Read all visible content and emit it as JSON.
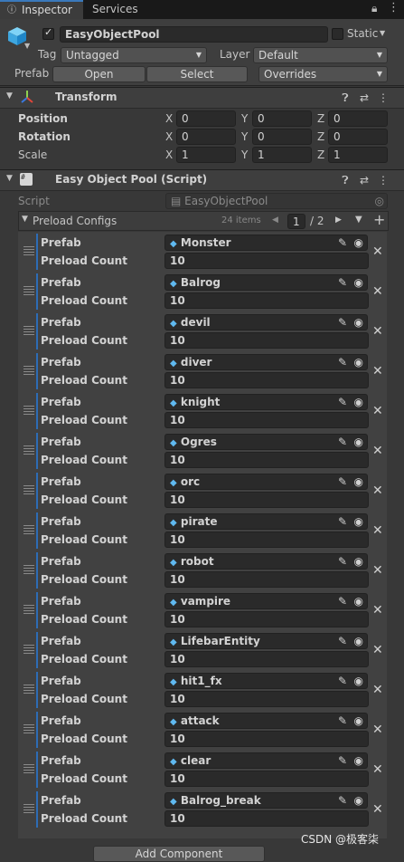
{
  "tabs": [
    {
      "label": "Inspector"
    },
    {
      "label": "Services"
    }
  ],
  "header": {
    "object_name": "EasyObjectPool",
    "static_label": "Static",
    "tag_label": "Tag",
    "tag_value": "Untagged",
    "layer_label": "Layer",
    "layer_value": "Default",
    "prefab_label": "Prefab",
    "open_label": "Open",
    "select_label": "Select",
    "overrides_label": "Overrides"
  },
  "transform": {
    "title": "Transform",
    "rows": [
      {
        "label": "Position",
        "x": "0",
        "y": "0",
        "z": "0"
      },
      {
        "label": "Rotation",
        "x": "0",
        "y": "0",
        "z": "0"
      },
      {
        "label": "Scale",
        "x": "1",
        "y": "1",
        "z": "1"
      }
    ],
    "axis": {
      "x": "X",
      "y": "Y",
      "z": "Z"
    }
  },
  "script_component": {
    "title": "Easy Object Pool (Script)",
    "script_label": "Script",
    "script_value": "EasyObjectPool",
    "list_label": "Preload Configs",
    "items_count": "24 items",
    "page_value": "1",
    "page_total": "/ 2",
    "prefab_label": "Prefab",
    "count_label": "Preload Count",
    "entries": [
      {
        "prefab": "Monster",
        "count": "10"
      },
      {
        "prefab": "Balrog",
        "count": "10"
      },
      {
        "prefab": "devil",
        "count": "10"
      },
      {
        "prefab": "diver",
        "count": "10"
      },
      {
        "prefab": "knight",
        "count": "10"
      },
      {
        "prefab": "Ogres",
        "count": "10"
      },
      {
        "prefab": "orc",
        "count": "10"
      },
      {
        "prefab": "pirate",
        "count": "10"
      },
      {
        "prefab": "robot",
        "count": "10"
      },
      {
        "prefab": "vampire",
        "count": "10"
      },
      {
        "prefab": "LifebarEntity",
        "count": "10"
      },
      {
        "prefab": "hit1_fx",
        "count": "10"
      },
      {
        "prefab": "attack",
        "count": "10"
      },
      {
        "prefab": "clear",
        "count": "10"
      },
      {
        "prefab": "Balrog_break",
        "count": "10"
      }
    ]
  },
  "footer": {
    "add_component": "Add Component",
    "watermark": "CSDN @极客柒"
  },
  "colors": {
    "accent": "#3a79bb",
    "prefab_blue": "#2d6cb5",
    "background": "#383838"
  }
}
